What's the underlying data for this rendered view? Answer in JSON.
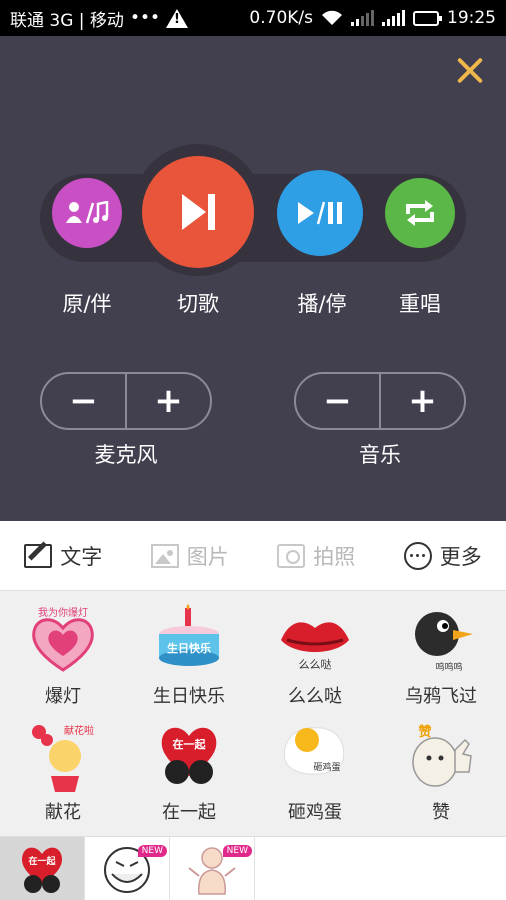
{
  "status_bar": {
    "carrier": "联通 3G | 移动",
    "dots": "•••",
    "speed": "0.70K/s",
    "time": "19:25"
  },
  "controls": {
    "buttons": [
      {
        "label": "原/伴",
        "icon": "vocal-accompaniment-icon",
        "color": "#c94fc4"
      },
      {
        "label": "切歌",
        "icon": "next-song-icon",
        "color": "#e8553b"
      },
      {
        "label": "播/停",
        "icon": "play-pause-icon",
        "color": "#2e9ee5"
      },
      {
        "label": "重唱",
        "icon": "repeat-icon",
        "color": "#5bb848"
      }
    ],
    "mic": {
      "label": "麦克风",
      "minus": "−",
      "plus": "+"
    },
    "music": {
      "label": "音乐",
      "minus": "−",
      "plus": "+"
    }
  },
  "toolbar": {
    "text": "文字",
    "picture": "图片",
    "photo": "拍照",
    "more": "更多"
  },
  "stickers": {
    "items": [
      {
        "label": "爆灯",
        "caption": "我为你爆灯"
      },
      {
        "label": "生日快乐",
        "caption": "生日快乐"
      },
      {
        "label": "么么哒",
        "caption": "么么哒"
      },
      {
        "label": "乌鸦飞过",
        "caption": "呜呜呜"
      },
      {
        "label": "献花",
        "caption": "献花啦"
      },
      {
        "label": "在一起",
        "caption": "在一起"
      },
      {
        "label": "砸鸡蛋",
        "caption": "砸鸡蛋"
      },
      {
        "label": "赞",
        "caption": "赞"
      }
    ]
  },
  "packs": {
    "first_caption": "在一起",
    "new_badge": "NEW"
  },
  "colors": {
    "panel_bg": "#423f4f",
    "close_accent": "#f0b84a"
  }
}
